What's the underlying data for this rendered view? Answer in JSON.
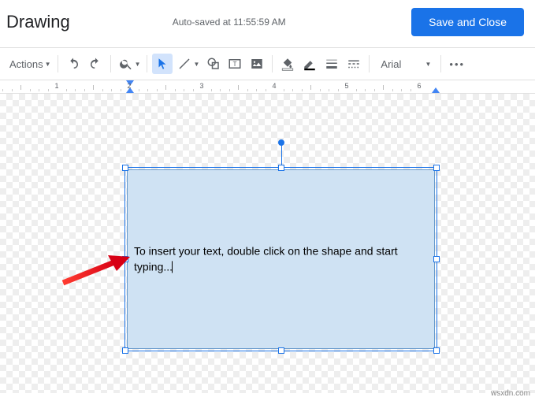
{
  "header": {
    "title": "Drawing",
    "autosave": "Auto-saved at 11:55:59 AM",
    "save_button": "Save and Close"
  },
  "toolbar": {
    "actions_label": "Actions",
    "font_name": "Arial"
  },
  "ruler": {
    "marks": [
      1,
      2,
      3,
      4,
      5
    ]
  },
  "shape": {
    "text": "To insert your text, double click on the shape and start typing..."
  },
  "watermark": "wsxdn.com"
}
